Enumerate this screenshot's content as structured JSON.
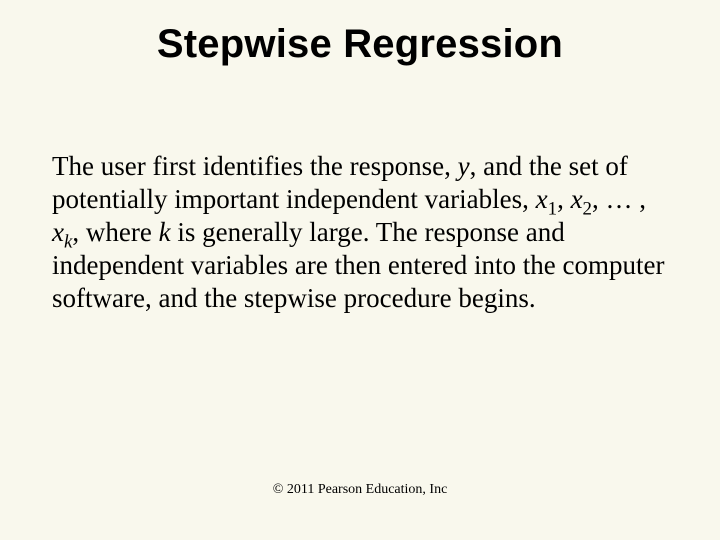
{
  "title": "Stepwise Regression",
  "body": {
    "t1": "The user first identifies the response, ",
    "y": "y",
    "t2": ", and the set of potentially important independent variables, ",
    "x": "x",
    "s1": "1",
    "c1": ", ",
    "s2": "2",
    "c2": ", … , ",
    "sk": "k",
    "t3": ", where ",
    "k": "k",
    "t4": " is generally large. The response and independent variables are then entered into the computer software, and the stepwise procedure begins."
  },
  "footer": "© 2011 Pearson Education, Inc"
}
